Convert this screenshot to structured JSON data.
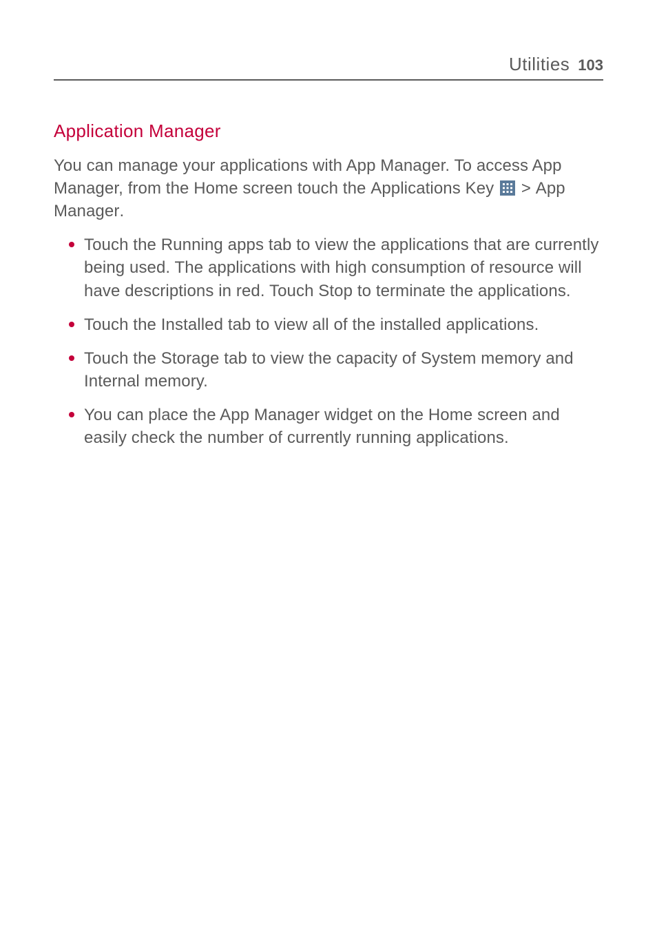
{
  "header": {
    "section": "Utilities",
    "page_number": "103"
  },
  "title": "Application Manager",
  "intro": {
    "p1": "You can manage your applications with App Manager. To access App Manager, from the Home screen touch the ",
    "k1": "Applications Key",
    "sep": " > ",
    "k2": "App Manager",
    "end": "."
  },
  "bullets": [
    {
      "a": "Touch the ",
      "b": "Running apps",
      "c": " tab to view the applications that are currently being used. The applications with high consumption of resource will have descriptions in red. Touch ",
      "d": "Stop",
      "e": " to terminate the applications."
    },
    {
      "a": "Touch the ",
      "b": "Installed",
      "c": " tab to view all of the installed applications."
    },
    {
      "a": "Touch the ",
      "b": "Storage",
      "c": " tab to view the capacity of System memory and Internal memory."
    },
    {
      "a": "You can place the App Manager widget on the Home screen and easily check the number of currently running applications."
    }
  ]
}
